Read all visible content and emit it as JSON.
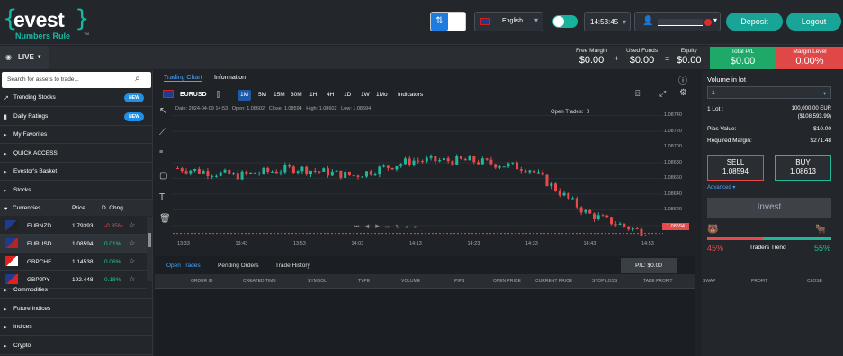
{
  "brand": {
    "name": "evest",
    "tagline": "Numbers Rule",
    "tm": "TM"
  },
  "topbar": {
    "swap_icon": "swap-arrows-icon",
    "language": "English",
    "time": "14:53:45",
    "deposit_label": "Deposit",
    "logout_label": "Logout",
    "chevron": "▾"
  },
  "account": {
    "mode_label": "LIVE",
    "free_margin_label": "Free Margin",
    "free_margin_value": "$0.00",
    "used_funds_label": "Used Funds",
    "used_funds_value": "$0.00",
    "equity_label": "Equity",
    "equity_value": "$0.00",
    "total_pl_label": "Total P/L",
    "total_pl_value": "$0.00",
    "margin_level_label": "Margin Level",
    "margin_level_value": "0.00%",
    "plus": "+",
    "equals": "="
  },
  "sidebar": {
    "search_placeholder": "Search for assets to trade...",
    "new_badge": "NEW",
    "items": [
      {
        "label": "Trending Stocks",
        "icon": "trend"
      },
      {
        "label": "Daily Ratings",
        "icon": "bars"
      },
      {
        "label": "My Favorites",
        "icon": "chevron-right"
      },
      {
        "label": "QUICK ACCESS",
        "icon": "chevron-right"
      },
      {
        "label": "Evestor's Basket",
        "icon": "chevron-right"
      },
      {
        "label": "Stocks",
        "icon": "chevron-right"
      }
    ],
    "currencies_header": {
      "label": "Currencies",
      "price": "Price",
      "change": "D. Chng"
    },
    "currency_rows": [
      {
        "symbol": "EURNZD",
        "price": "1.79393",
        "change": "-0.35%",
        "color": "#e64a4a"
      },
      {
        "symbol": "EURUSD",
        "price": "1.08594",
        "change": "0.01%",
        "color": "#1fcf8a"
      },
      {
        "symbol": "GBPCHF",
        "price": "1.14538",
        "change": "0.06%",
        "color": "#1fcf8a"
      },
      {
        "symbol": "GBPJPY",
        "price": "192.448",
        "change": "0.18%",
        "color": "#1fcf8a"
      }
    ],
    "bottom_items": [
      {
        "label": "Commodities"
      },
      {
        "label": "Future Indices"
      },
      {
        "label": "Indices"
      },
      {
        "label": "Crypto"
      }
    ]
  },
  "chart": {
    "tabs": {
      "trading_chart": "Trading Chart",
      "information": "Information"
    },
    "symbol": "EURUSD",
    "timeframes": [
      "1M",
      "5M",
      "15M",
      "30M",
      "1H",
      "4H",
      "1D",
      "1W",
      "1Mo"
    ],
    "indicators_label": "Indicators",
    "ohlc": {
      "date": "Date: 2024-04-09 14:53",
      "open": "Open: 1.08602",
      "close": "Close: 1.08594",
      "high": "High: 1.08602",
      "low": "Low: 1.08594"
    },
    "open_trades_label": "Open Trades:",
    "open_trades_value": "0",
    "price_ticks": [
      "1.08740",
      "1.08720",
      "1.08700",
      "1.08680",
      "1.08660",
      "1.08640",
      "1.08620",
      "1.08600"
    ],
    "time_ticks": [
      "13:33",
      "13:43",
      "13:53",
      "14:03",
      "14:13",
      "14:23",
      "14:33",
      "14:43",
      "14:53"
    ],
    "current_price": "1.08594",
    "colors": {
      "up": "#1fb89a",
      "down": "#e64a4a"
    }
  },
  "chart_data": {
    "type": "candlestick",
    "x": [
      "13:33",
      "13:43",
      "13:53",
      "14:03",
      "14:13",
      "14:23",
      "14:33",
      "14:43",
      "14:53"
    ],
    "y_ticks": [
      1.0874,
      1.0872,
      1.087,
      1.0868,
      1.0866,
      1.0864,
      1.0862,
      1.086
    ],
    "close_approx": [
      1.0868,
      1.0867,
      1.0868,
      1.0867,
      1.0869,
      1.0869,
      1.0868,
      1.0862,
      1.08594
    ],
    "last_price": 1.08594,
    "title": "EURUSD"
  },
  "order": {
    "volume_label": "Volume in lot",
    "volume_value": "1",
    "lot_label": "1 Lot :",
    "lot_value": "100,000.00 EUR",
    "lot_value2": "($108,593.99)",
    "pips_label": "Pips Value:",
    "pips_value": "$10.00",
    "margin_label": "Required Margin:",
    "margin_value": "$271.48",
    "sell_label": "SELL",
    "sell_price": "1.08594",
    "buy_label": "BUY",
    "buy_price": "1.08613",
    "advanced_label": "Advanced ▾",
    "invest_label": "Invest",
    "bear_pct": "45%",
    "bull_pct": "55%",
    "traders_trend_label": "Traders Trend",
    "bear_share": 0.45
  },
  "bottom": {
    "tabs": [
      "Open Trades",
      "Pending Orders",
      "Trade History"
    ],
    "pl_label": "P/L: $0.00",
    "columns": [
      "ORDER ID",
      "CREATED TIME",
      "SYMBOL",
      "TYPE",
      "VOLUME",
      "PIPS",
      "OPEN PRICE",
      "CURRENT PRICE",
      "STOP LOSS",
      "TAKE PROFIT",
      "SWAP",
      "PROFIT",
      "CLOSE"
    ]
  }
}
